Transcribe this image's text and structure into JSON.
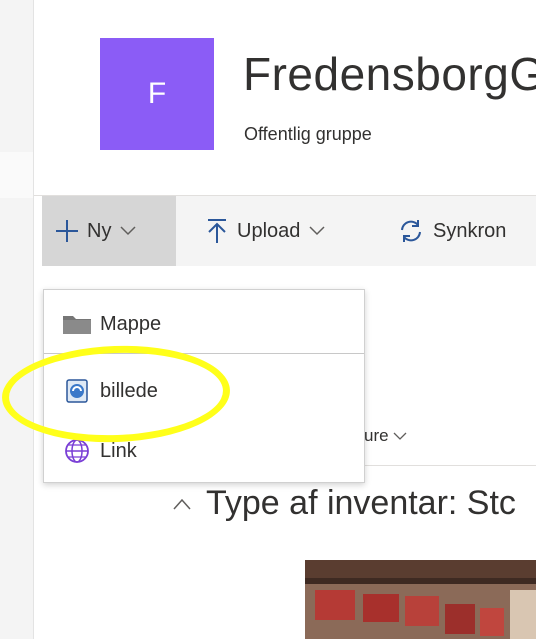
{
  "group": {
    "avatar_letter": "F",
    "name": "FredensborgG",
    "privacy": "Offentlig gruppe"
  },
  "command_bar": {
    "new_label": "Ny",
    "upload_label": "Upload",
    "sync_label": "Synkron"
  },
  "new_menu": {
    "items": [
      {
        "label": "Mappe",
        "icon": "folder-icon"
      },
      {
        "label": "billede",
        "icon": "web-part-icon"
      },
      {
        "label": "Link",
        "icon": "globe-icon"
      }
    ]
  },
  "list": {
    "column_fragment": "ure",
    "group_header": "Type af inventar: Stc"
  },
  "colors": {
    "avatar": "#8b5cf6",
    "accent": "#2b579a",
    "highlight": "#ffff1a"
  }
}
